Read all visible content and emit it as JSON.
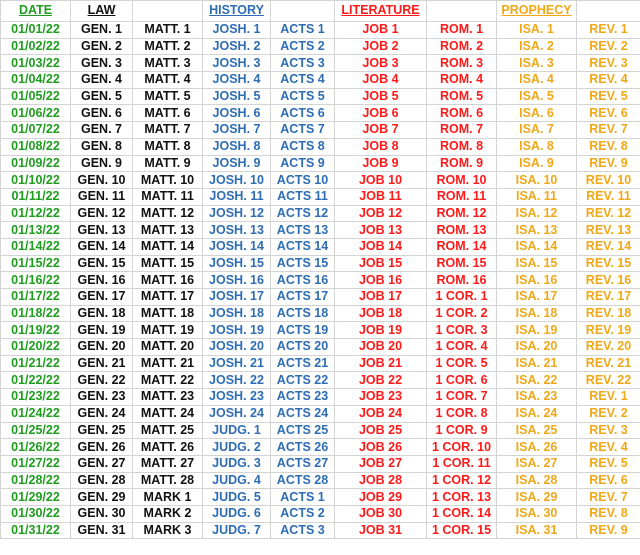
{
  "headers": {
    "date": "DATE",
    "law": "LAW",
    "history": "HISTORY",
    "literature": "LITERATURE",
    "prophecy": "PROPHECY"
  },
  "colors": {
    "date": "#1f9d1f",
    "law": "#111111",
    "history": "#2e6db4",
    "literature": "#ff1a1a",
    "prophecy": "#f0a818"
  },
  "rows": [
    [
      "01/01/22",
      "GEN. 1",
      "MATT. 1",
      "JOSH. 1",
      "ACTS 1",
      "JOB 1",
      "ROM. 1",
      "ISA. 1",
      "REV. 1"
    ],
    [
      "01/02/22",
      "GEN. 2",
      "MATT. 2",
      "JOSH. 2",
      "ACTS 2",
      "JOB 2",
      "ROM. 2",
      "ISA. 2",
      "REV. 2"
    ],
    [
      "01/03/22",
      "GEN. 3",
      "MATT. 3",
      "JOSH. 3",
      "ACTS 3",
      "JOB 3",
      "ROM. 3",
      "ISA. 3",
      "REV. 3"
    ],
    [
      "01/04/22",
      "GEN. 4",
      "MATT. 4",
      "JOSH. 4",
      "ACTS 4",
      "JOB 4",
      "ROM. 4",
      "ISA. 4",
      "REV. 4"
    ],
    [
      "01/05/22",
      "GEN. 5",
      "MATT. 5",
      "JOSH. 5",
      "ACTS 5",
      "JOB 5",
      "ROM. 5",
      "ISA. 5",
      "REV. 5"
    ],
    [
      "01/06/22",
      "GEN. 6",
      "MATT. 6",
      "JOSH. 6",
      "ACTS 6",
      "JOB 6",
      "ROM. 6",
      "ISA. 6",
      "REV. 6"
    ],
    [
      "01/07/22",
      "GEN. 7",
      "MATT. 7",
      "JOSH. 7",
      "ACTS 7",
      "JOB 7",
      "ROM. 7",
      "ISA. 7",
      "REV. 7"
    ],
    [
      "01/08/22",
      "GEN. 8",
      "MATT. 8",
      "JOSH. 8",
      "ACTS 8",
      "JOB 8",
      "ROM. 8",
      "ISA. 8",
      "REV. 8"
    ],
    [
      "01/09/22",
      "GEN. 9",
      "MATT. 9",
      "JOSH. 9",
      "ACTS 9",
      "JOB 9",
      "ROM. 9",
      "ISA. 9",
      "REV. 9"
    ],
    [
      "01/10/22",
      "GEN. 10",
      "MATT. 10",
      "JOSH. 10",
      "ACTS 10",
      "JOB 10",
      "ROM. 10",
      "ISA. 10",
      "REV. 10"
    ],
    [
      "01/11/22",
      "GEN. 11",
      "MATT. 11",
      "JOSH. 11",
      "ACTS 11",
      "JOB 11",
      "ROM. 11",
      "ISA. 11",
      "REV. 11"
    ],
    [
      "01/12/22",
      "GEN. 12",
      "MATT. 12",
      "JOSH. 12",
      "ACTS 12",
      "JOB 12",
      "ROM. 12",
      "ISA. 12",
      "REV. 12"
    ],
    [
      "01/13/22",
      "GEN. 13",
      "MATT. 13",
      "JOSH. 13",
      "ACTS 13",
      "JOB 13",
      "ROM. 13",
      "ISA. 13",
      "REV. 13"
    ],
    [
      "01/14/22",
      "GEN. 14",
      "MATT. 14",
      "JOSH. 14",
      "ACTS 14",
      "JOB 14",
      "ROM. 14",
      "ISA. 14",
      "REV. 14"
    ],
    [
      "01/15/22",
      "GEN. 15",
      "MATT. 15",
      "JOSH. 15",
      "ACTS 15",
      "JOB 15",
      "ROM. 15",
      "ISA. 15",
      "REV. 15"
    ],
    [
      "01/16/22",
      "GEN. 16",
      "MATT. 16",
      "JOSH. 16",
      "ACTS 16",
      "JOB 16",
      "ROM. 16",
      "ISA. 16",
      "REV. 16"
    ],
    [
      "01/17/22",
      "GEN. 17",
      "MATT. 17",
      "JOSH. 17",
      "ACTS 17",
      "JOB 17",
      "1 COR. 1",
      "ISA. 17",
      "REV. 17"
    ],
    [
      "01/18/22",
      "GEN. 18",
      "MATT. 18",
      "JOSH. 18",
      "ACTS 18",
      "JOB 18",
      "1 COR. 2",
      "ISA. 18",
      "REV. 18"
    ],
    [
      "01/19/22",
      "GEN. 19",
      "MATT. 19",
      "JOSH. 19",
      "ACTS 19",
      "JOB 19",
      "1 COR. 3",
      "ISA. 19",
      "REV. 19"
    ],
    [
      "01/20/22",
      "GEN. 20",
      "MATT. 20",
      "JOSH. 20",
      "ACTS 20",
      "JOB 20",
      "1 COR. 4",
      "ISA. 20",
      "REV. 20"
    ],
    [
      "01/21/22",
      "GEN. 21",
      "MATT. 21",
      "JOSH. 21",
      "ACTS 21",
      "JOB 21",
      "1 COR. 5",
      "ISA. 21",
      "REV. 21"
    ],
    [
      "01/22/22",
      "GEN. 22",
      "MATT. 22",
      "JOSH. 22",
      "ACTS 22",
      "JOB 22",
      "1 COR. 6",
      "ISA. 22",
      "REV. 22"
    ],
    [
      "01/23/22",
      "GEN. 23",
      "MATT. 23",
      "JOSH. 23",
      "ACTS 23",
      "JOB 23",
      "1 COR. 7",
      "ISA. 23",
      "REV. 1"
    ],
    [
      "01/24/22",
      "GEN. 24",
      "MATT. 24",
      "JOSH. 24",
      "ACTS 24",
      "JOB 24",
      "1 COR. 8",
      "ISA. 24",
      "REV. 2"
    ],
    [
      "01/25/22",
      "GEN. 25",
      "MATT. 25",
      "JUDG. 1",
      "ACTS 25",
      "JOB 25",
      "1 COR. 9",
      "ISA. 25",
      "REV. 3"
    ],
    [
      "01/26/22",
      "GEN. 26",
      "MATT. 26",
      "JUDG. 2",
      "ACTS 26",
      "JOB 26",
      "1 COR. 10",
      "ISA. 26",
      "REV. 4"
    ],
    [
      "01/27/22",
      "GEN. 27",
      "MATT. 27",
      "JUDG. 3",
      "ACTS 27",
      "JOB 27",
      "1 COR. 11",
      "ISA. 27",
      "REV. 5"
    ],
    [
      "01/28/22",
      "GEN. 28",
      "MATT. 28",
      "JUDG. 4",
      "ACTS 28",
      "JOB 28",
      "1 COR. 12",
      "ISA. 28",
      "REV. 6"
    ],
    [
      "01/29/22",
      "GEN. 29",
      "MARK 1",
      "JUDG. 5",
      "ACTS 1",
      "JOB 29",
      "1 COR. 13",
      "ISA. 29",
      "REV. 7"
    ],
    [
      "01/30/22",
      "GEN. 30",
      "MARK 2",
      "JUDG. 6",
      "ACTS 2",
      "JOB 30",
      "1 COR. 14",
      "ISA. 30",
      "REV. 8"
    ],
    [
      "01/31/22",
      "GEN. 31",
      "MARK 3",
      "JUDG. 7",
      "ACTS 3",
      "JOB 31",
      "1 COR. 15",
      "ISA. 31",
      "REV. 9"
    ]
  ]
}
